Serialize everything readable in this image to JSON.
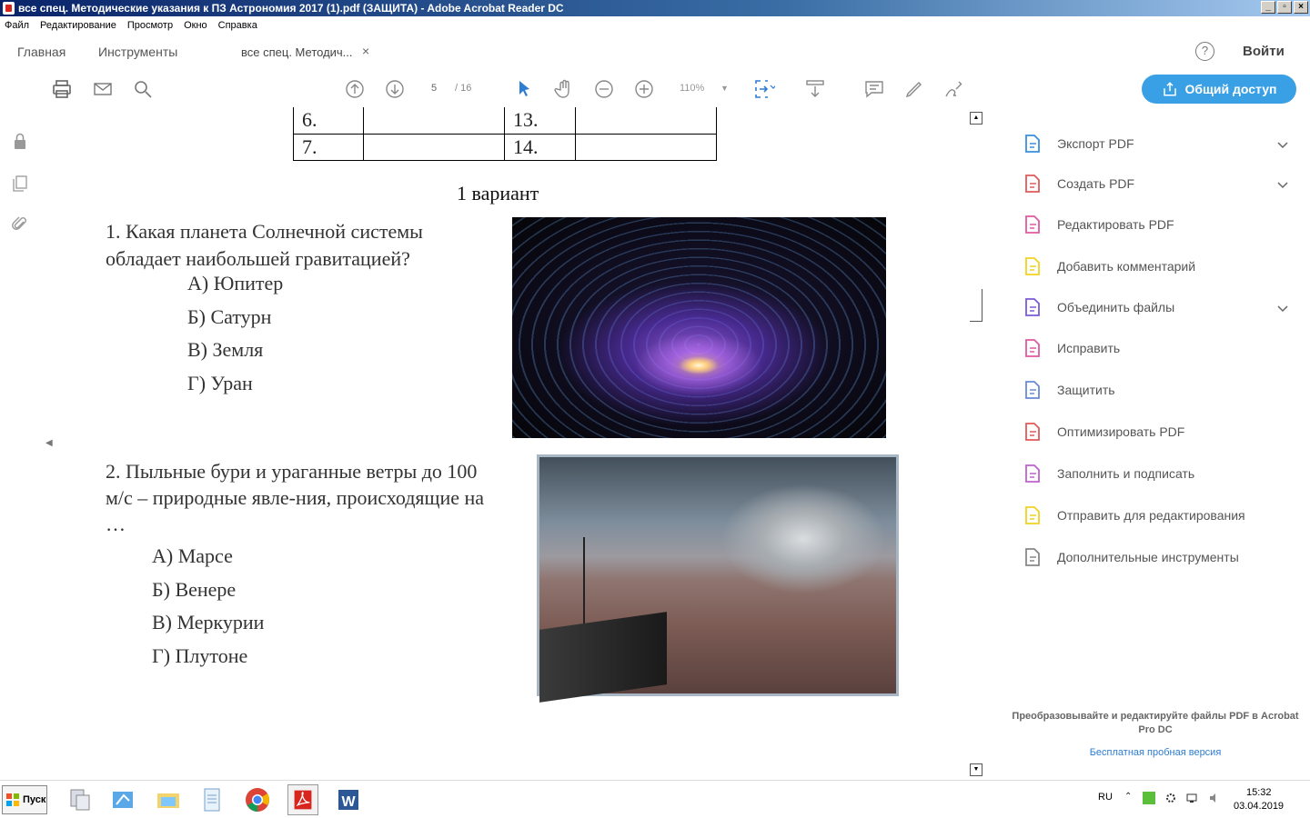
{
  "window": {
    "title": "все спец. Методические указания к ПЗ Астрономия 2017 (1).pdf (ЗАЩИТА) - Adobe Acrobat Reader DC",
    "buttons": [
      "_",
      "▫",
      "×"
    ]
  },
  "menubar": [
    "Файл",
    "Редактирование",
    "Просмотр",
    "Окно",
    "Справка"
  ],
  "tabs": {
    "home": "Главная",
    "tools": "Инструменты",
    "document": "все спец. Методич...",
    "close": "×"
  },
  "header_right": {
    "login": "Войти",
    "help": "?"
  },
  "toolbar": {
    "page_current": "5",
    "page_total": "/ 16",
    "zoom": "110%",
    "share_label": "Общий доступ"
  },
  "document": {
    "table_rows": [
      [
        "6.",
        "",
        "13.",
        ""
      ],
      [
        "7.",
        "",
        "14.",
        ""
      ]
    ],
    "variant_title": "1 вариант",
    "question1": {
      "text": "1. Какая планета Солнечной системы обладает наибольшей гравитацией?",
      "options": [
        "А) Юпитер",
        "Б) Сатурн",
        "В) Земля",
        "Г) Уран"
      ]
    },
    "question2": {
      "text": "2. Пыльные бури и ураганные ветры до 100 м/с – природные  явле-ния, происходящие на …",
      "options": [
        "А) Марсе",
        "Б) Венере",
        "В) Меркурии",
        "Г) Плутоне"
      ]
    }
  },
  "tools_pane": {
    "items": [
      {
        "label": "Экспорт PDF",
        "icon": "export-pdf-icon",
        "color": "#3a8fe0",
        "chevron": true
      },
      {
        "label": "Создать PDF",
        "icon": "create-pdf-icon",
        "color": "#e05a5a",
        "chevron": true
      },
      {
        "label": "Редактировать PDF",
        "icon": "edit-pdf-icon",
        "color": "#e05aa0",
        "chevron": false
      },
      {
        "label": "Добавить комментарий",
        "icon": "comment-icon",
        "color": "#f0d21e",
        "chevron": false
      },
      {
        "label": "Объединить файлы",
        "icon": "combine-files-icon",
        "color": "#7a5ad8",
        "chevron": true
      },
      {
        "label": "Исправить",
        "icon": "fix-icon",
        "color": "#e05aa0",
        "chevron": false
      },
      {
        "label": "Защитить",
        "icon": "protect-icon",
        "color": "#6a8ad8",
        "chevron": false
      },
      {
        "label": "Оптимизировать PDF",
        "icon": "optimize-pdf-icon",
        "color": "#e05a5a",
        "chevron": false
      },
      {
        "label": "Заполнить и подписать",
        "icon": "fill-sign-icon",
        "color": "#c060d0",
        "chevron": false
      },
      {
        "label": "Отправить для редактирования",
        "icon": "send-review-icon",
        "color": "#f0d21e",
        "chevron": false
      },
      {
        "label": "Дополнительные инструменты",
        "icon": "more-tools-icon",
        "color": "#888888",
        "chevron": false
      }
    ],
    "promo": "Преобразовывайте и редактируйте файлы PDF в Acrobat Pro DC",
    "trial_link": "Бесплатная пробная версия"
  },
  "taskbar": {
    "start": "Пуск",
    "lang": "RU",
    "time": "15:32",
    "date": "03.04.2019"
  },
  "colors": {
    "accent": "#3aa0e6",
    "titlebar": "#0a246a"
  }
}
